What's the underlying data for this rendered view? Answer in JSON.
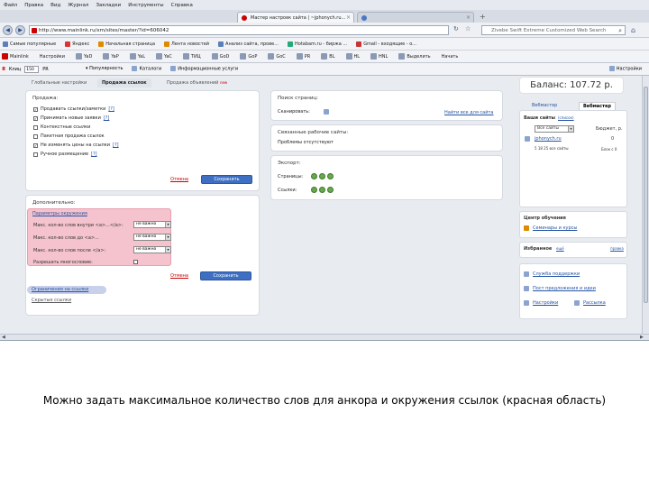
{
  "menubar": [
    "Файл",
    "Правка",
    "Вид",
    "Журнал",
    "Закладки",
    "Инструменты",
    "Справка"
  ],
  "tabs": [
    {
      "label": "Мастер настроек сайта | ~jphonych.ru..."
    },
    {
      "label": ""
    }
  ],
  "url": "http://www.mainlink.ru/xm/sites/master/?id=606042",
  "search_placeholder": "Zivebe Swift Extreme Customized Web Search",
  "bookmarks": [
    "Самые популярные",
    "Яндекс",
    "Начальная страница",
    "Лента новостей",
    "Анализ сайта, прове...",
    "Hotabam.ru - биржа ...",
    "Gmail - входящие - o..."
  ],
  "toolbar2": {
    "items": [
      "Mainlink",
      "Настройки",
      "YaD",
      "YaP",
      "YaL",
      "YaC",
      "ТИЦ",
      "GoD",
      "GoP",
      "GoC",
      "PR",
      "BL",
      "HL",
      "HNL",
      "Выделить",
      "Начать"
    ],
    "settings": "Настройки"
  },
  "toolbar3": {
    "label": "Клиц",
    "value": "150",
    "value2": "PR",
    "items": [
      "Популярность",
      "Каталоги",
      "Информационные услуги"
    ],
    "settings": "Настройки"
  },
  "page_tabs": [
    {
      "label": "Глобальные настройки"
    },
    {
      "label": "Продажа ссылок"
    },
    {
      "label": "Продажа объявлений",
      "badge": "new"
    }
  ],
  "sale": {
    "title": "Продажа:",
    "options": [
      {
        "label": "Продавать ссылки/заметки",
        "checked": "✓",
        "link": "[?]"
      },
      {
        "label": "Принимать новые заявки",
        "checked": "✓",
        "link": "[?]"
      },
      {
        "label": "Контекстные ссылки",
        "checked": "",
        "link": ""
      },
      {
        "label": "Пакетная продажа ссылок",
        "checked": "",
        "link": ""
      },
      {
        "label": "Не изменять цены на ссылки",
        "checked": "✓",
        "link": "[?]"
      },
      {
        "label": "Ручное размещение",
        "checked": "",
        "link": "[?]"
      }
    ],
    "cancel": "Отмена",
    "save": "Сохранить"
  },
  "additional": {
    "title": "Дополнительно:",
    "params_link": "Параметры окружения",
    "rows": [
      {
        "label": "Макс. кол-во слов внутри <a>...</a>:",
        "value": "не важно"
      },
      {
        "label": "Макс. кол-во слов до <a>...",
        "value": "не важно"
      },
      {
        "label": "Макс. кол-во слов после </a>:",
        "value": "не важно"
      }
    ],
    "multi_label": "Разрешать многословие:",
    "cancel": "Отмена",
    "save": "Сохранить",
    "restrictions_link": "Ограничения на ссылки",
    "hidden_pages": "Скрытые ссылки"
  },
  "search_pages": {
    "title": "Поиск страниц:",
    "scan": "Сканировать:",
    "link": "Найти все для сайта"
  },
  "linked": {
    "title": "Связанные рабочие сайты:",
    "value": "Проблемы отсутствуют"
  },
  "export": {
    "title": "Экспорт:",
    "pages": "Страницы:",
    "links": "Ссылки:"
  },
  "right": {
    "balance": "Баланс: 107.72 р.",
    "tabs": [
      "Вебмастер",
      "Вебмастер"
    ],
    "sites_title": "Ваши сайты",
    "sites_link": "(список)",
    "all_sites": "Все сайты",
    "budget": "Бюджет, р.",
    "site_name": "jphonych.ru",
    "site_value": "0",
    "counts": "5 18 25 все сайты",
    "blocked": "Блок с 0",
    "training_title": "Центр обучения",
    "training_link": "Семинары и курсы",
    "favorites_title": "Избранное",
    "favorites_link": "ещё",
    "favorites_right": "правка",
    "support": "Служба поддержки",
    "ideas": "Пост предложения и идеи",
    "settings": "Настройки",
    "mailing": "Рассылка"
  },
  "caption": "Можно задать максимальное количество слов для анкора и окружения ссылок (красная область)"
}
